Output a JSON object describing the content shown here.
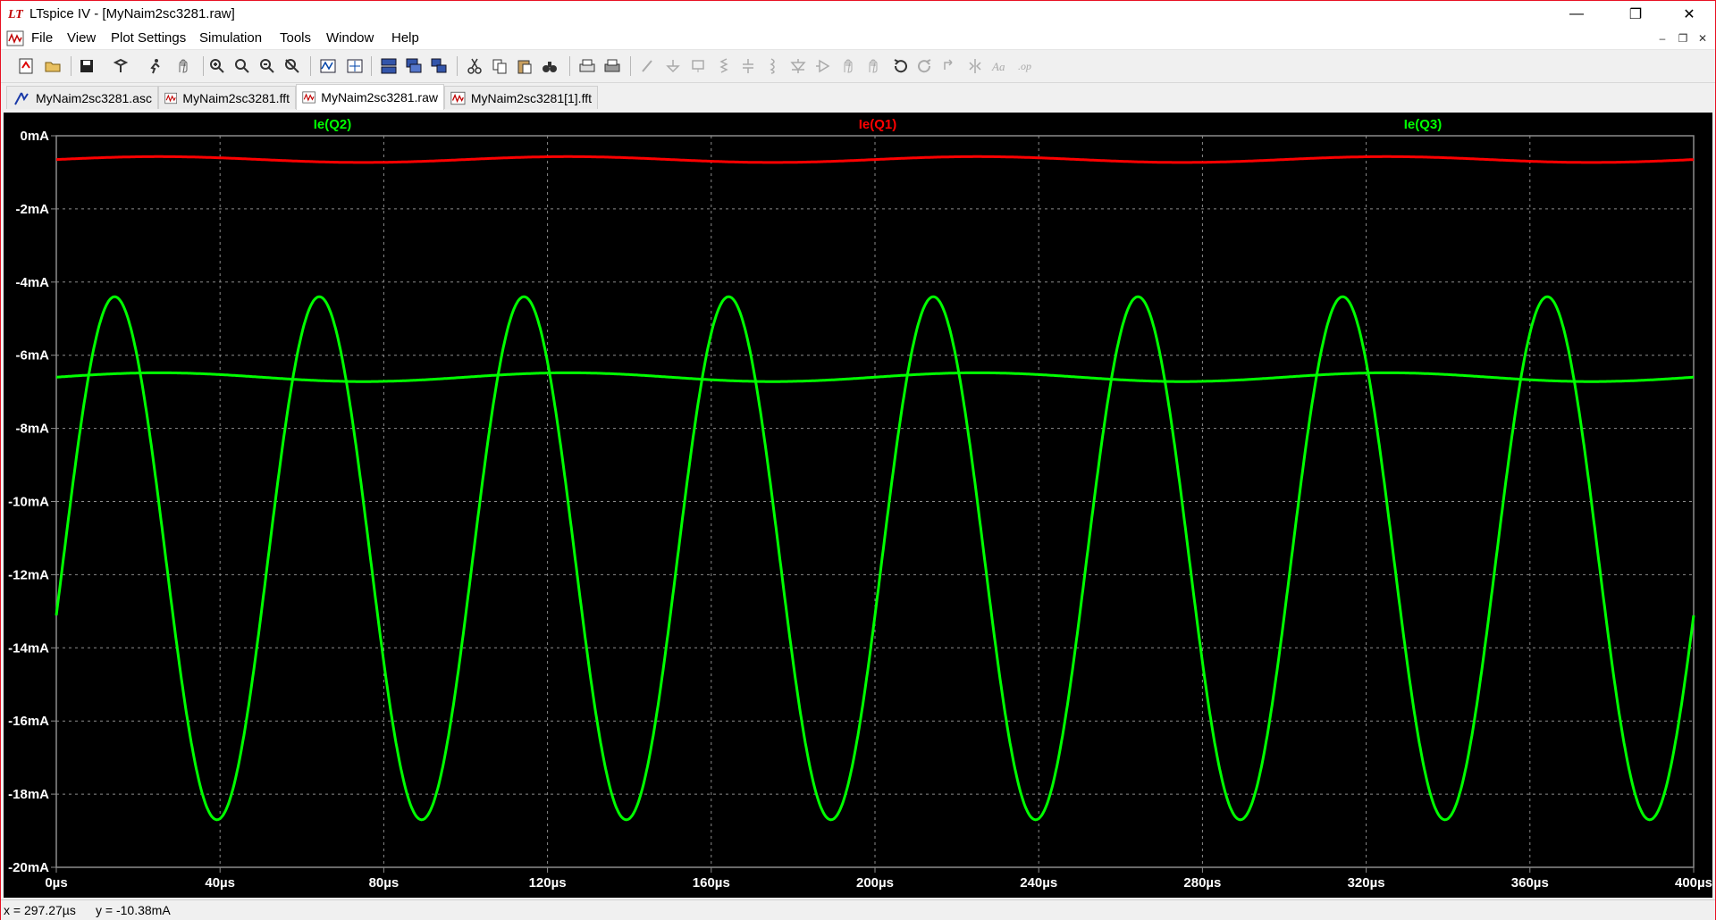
{
  "window": {
    "title": "LTspice IV - [MyNaim2sc3281.raw]",
    "minimize": "—",
    "restore": "❐",
    "close": "✕"
  },
  "menu": {
    "items": [
      "File",
      "View",
      "Plot Settings",
      "Simulation",
      "Tools",
      "Window",
      "Help"
    ],
    "mdi_minimize": "–",
    "mdi_restore": "❐",
    "mdi_close": "✕"
  },
  "toolbar": {
    "buttons": [
      "new-schematic-icon",
      "open-icon",
      "save-icon",
      "control-panel-icon",
      "run-icon",
      "halt-icon",
      "zoom-in-icon",
      "zoom-area-icon",
      "zoom-out-icon",
      "zoom-fit-icon",
      "autorange-icon",
      "cursor-icon",
      "tile-horizontal-icon",
      "cascade-icon",
      "tile-vertical-icon",
      "cut-icon",
      "copy-icon",
      "paste-icon",
      "find-icon",
      "print-preview-icon",
      "print-icon",
      "wire-icon",
      "ground-icon",
      "label-icon",
      "resistor-icon",
      "capacitor-icon",
      "inductor-icon",
      "diode-icon",
      "component-icon",
      "move-icon",
      "drag-icon",
      "undo-icon",
      "redo-icon",
      "rotate-icon",
      "mirror-icon",
      "text-icon",
      "spice-directive-icon"
    ]
  },
  "tabs": [
    {
      "label": "MyNaim2sc3281.asc",
      "icon": "schematic-icon"
    },
    {
      "label": "MyNaim2sc3281.fft",
      "icon": "waveform-icon"
    },
    {
      "label": "MyNaim2sc3281.raw",
      "icon": "waveform-icon",
      "active": true
    },
    {
      "label": "MyNaim2sc3281[1].fft",
      "icon": "waveform-icon"
    }
  ],
  "colors": {
    "red_trace": "#ff0000",
    "green_trace": "#00ff00",
    "background": "#000000",
    "grid": "#8c8c8c",
    "axis_text": "#ffffff"
  },
  "chart_data": {
    "type": "line",
    "xlabel": "",
    "ylabel": "",
    "xlim": [
      0,
      400
    ],
    "ylim": [
      -20,
      0
    ],
    "x_unit": "µs",
    "y_unit": "mA",
    "xticks": [
      "0µs",
      "40µs",
      "80µs",
      "120µs",
      "160µs",
      "200µs",
      "240µs",
      "280µs",
      "320µs",
      "360µs",
      "400µs"
    ],
    "yticks": [
      "0mA",
      "-2mA",
      "-4mA",
      "-6mA",
      "-8mA",
      "-10mA",
      "-12mA",
      "-14mA",
      "-16mA",
      "-18mA",
      "-20mA"
    ],
    "grid": true,
    "legend": [
      "Ie(Q2)",
      "Ie(Q1)",
      "Ie(Q3)"
    ],
    "series": [
      {
        "name": "Ie(Q1)",
        "color": "#ff0000",
        "shape": "sine",
        "offset": -0.65,
        "amplitude": 0.08,
        "period": 100,
        "phase": 0
      },
      {
        "name": "Ie(Q2)",
        "color": "#00ff00",
        "shape": "sine",
        "offset": -6.6,
        "amplitude": 0.12,
        "period": 100,
        "phase": 0
      },
      {
        "name": "Ie(Q3)",
        "color": "#00ff00",
        "shape": "sine",
        "offset": -11.55,
        "amplitude": 7.15,
        "period": 50,
        "phase": -0.22
      }
    ],
    "cursor_readout": {
      "x": "x = 297.27µs",
      "y": "y = -10.38mA"
    }
  }
}
